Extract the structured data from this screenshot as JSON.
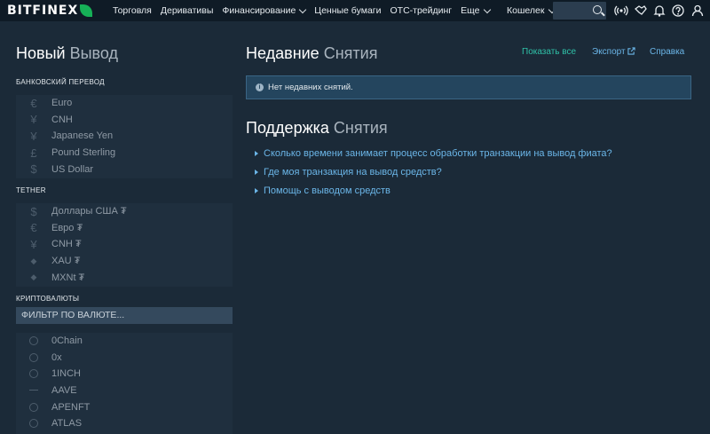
{
  "header": {
    "logo": "BITFINEX",
    "nav": [
      "Торговля",
      "Деривативы",
      "Финансирование",
      "Ценные бумаги",
      "OTC-трейдинг",
      "Еще"
    ],
    "wallet": "Кошелек"
  },
  "left": {
    "title_main": "Новый",
    "title_sub": "Вывод",
    "bank_label": "БАНКОВСКИЙ ПЕРЕВОД",
    "bank_items": [
      {
        "sym": "€",
        "label": "Euro"
      },
      {
        "sym": "¥",
        "label": "CNH"
      },
      {
        "sym": "¥",
        "label": "Japanese Yen"
      },
      {
        "sym": "£",
        "label": "Pound Sterling"
      },
      {
        "sym": "$",
        "label": "US Dollar"
      }
    ],
    "tether_label": "TETHER",
    "tether_items": [
      {
        "sym": "$",
        "label": "Доллары США ₮"
      },
      {
        "sym": "€",
        "label": "Евро ₮"
      },
      {
        "sym": "¥",
        "label": "CNH ₮"
      },
      {
        "sym": "◆",
        "label": "XAU ₮"
      },
      {
        "sym": "◆",
        "label": "MXNt ₮"
      }
    ],
    "crypto_label": "КРИПТОВАЛЮТЫ",
    "filter_placeholder": "ФИЛЬТР ПО ВАЛЮТЕ...",
    "crypto_items": [
      "0Chain",
      "0x",
      "1INCH",
      "AAVE",
      "APENFT",
      "ATLAS"
    ]
  },
  "right": {
    "title_main": "Недавние",
    "title_sub": "Снятия",
    "show_all": "Показать все",
    "export": "Экспорт",
    "help": "Справка",
    "notice": "Нет недавних снятий.",
    "support_main": "Поддержка",
    "support_sub": "Снятия",
    "faq": [
      "Сколько времени занимает процесс обработки транзакции на вывод фиата?",
      "Где моя транзакция на вывод средств?",
      "Помощь с выводом средств"
    ]
  }
}
